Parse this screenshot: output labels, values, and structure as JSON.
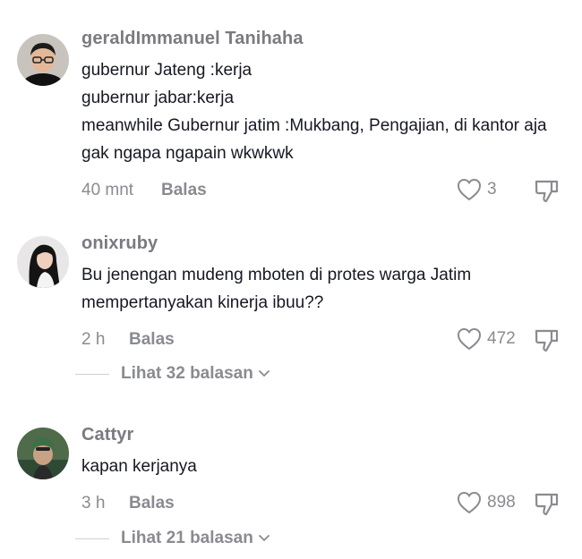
{
  "comments": [
    {
      "username": "geraldImmanuel Tanihaha",
      "lines": [
        "gubernur Jateng :kerja",
        "gubernur jabar:kerja",
        "meanwhile Gubernur jatim :Mukbang, Pengajian, di kantor aja",
        "gak ngapa ngapain wkwkwk"
      ],
      "time": "40 mnt",
      "reply_label": "Balas",
      "likes": "3",
      "avatar_icon": "person-avatar-glasses"
    },
    {
      "username": "onixruby",
      "lines": [
        "Bu jenengan mudeng mboten di protes warga Jatim",
        "mempertanyakan kinerja ibuu??"
      ],
      "time": "2 h",
      "reply_label": "Balas",
      "likes": "472",
      "avatar_icon": "person-avatar-woman",
      "view_replies": "Lihat 32 balasan"
    },
    {
      "username": "Cattyr",
      "lines": [
        "kapan kerjanya"
      ],
      "time": "3 h",
      "reply_label": "Balas",
      "likes": "898",
      "avatar_icon": "person-avatar-helmet",
      "view_replies": "Lihat 21 balasan"
    }
  ],
  "colors": {
    "text": "#161823",
    "muted": "#8a8b91",
    "username": "#7a7a80",
    "background": "#ffffff"
  }
}
